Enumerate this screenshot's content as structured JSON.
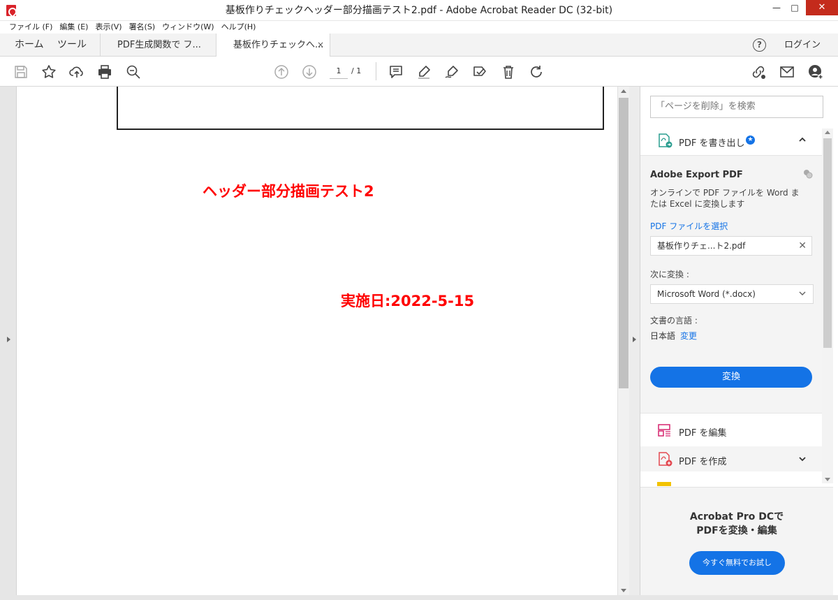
{
  "window": {
    "title": "基板作りチェックヘッダー部分描画テスト2.pdf - Adobe Acrobat Reader DC (32-bit)",
    "minimize": "—",
    "maximize": "□",
    "close": "✕"
  },
  "menu": [
    "ファイル (F)",
    "編集 (E)",
    "表示(V)",
    "署名(S)",
    "ウィンドウ(W)",
    "ヘルプ(H)"
  ],
  "tabs": {
    "home": "ホーム",
    "tools": "ツール",
    "doc1": "PDF生成関数で フ...",
    "doc2": "基板作りチェックへ...",
    "close": "×",
    "login": "ログイン",
    "help": "?"
  },
  "toolbar": {
    "page_current": "1",
    "page_total": "/ 1"
  },
  "document": {
    "heading": "ヘッダー部分描画テスト2",
    "date": "実施日:2022-5-15"
  },
  "right_pane": {
    "search_placeholder": "「ページを削除」を検索",
    "export_label": "PDF を書き出し",
    "export_panel": {
      "title": "Adobe Export PDF",
      "description": "オンラインで PDF ファイルを Word または Excel に変換します",
      "select_link": "PDF ファイルを選択",
      "file_name": "基板作りチェ...ト2.pdf",
      "file_clear": "✕",
      "convert_to_label": "次に変換 :",
      "format": "Microsoft Word (*.docx)",
      "language_label": "文書の言語 :",
      "language_value": "日本語",
      "language_change": "変更",
      "convert_button": "変換"
    },
    "tools": {
      "edit_pdf": "PDF を編集",
      "create_pdf": "PDF を作成"
    },
    "promo": {
      "line1": "Acrobat Pro DCで",
      "line2": "PDFを変換・編集",
      "button": "今すぐ無料でお試し"
    }
  },
  "colors": {
    "accent": "#1473e6",
    "doc_text": "#ff0000",
    "close_button": "#c42b1c"
  }
}
